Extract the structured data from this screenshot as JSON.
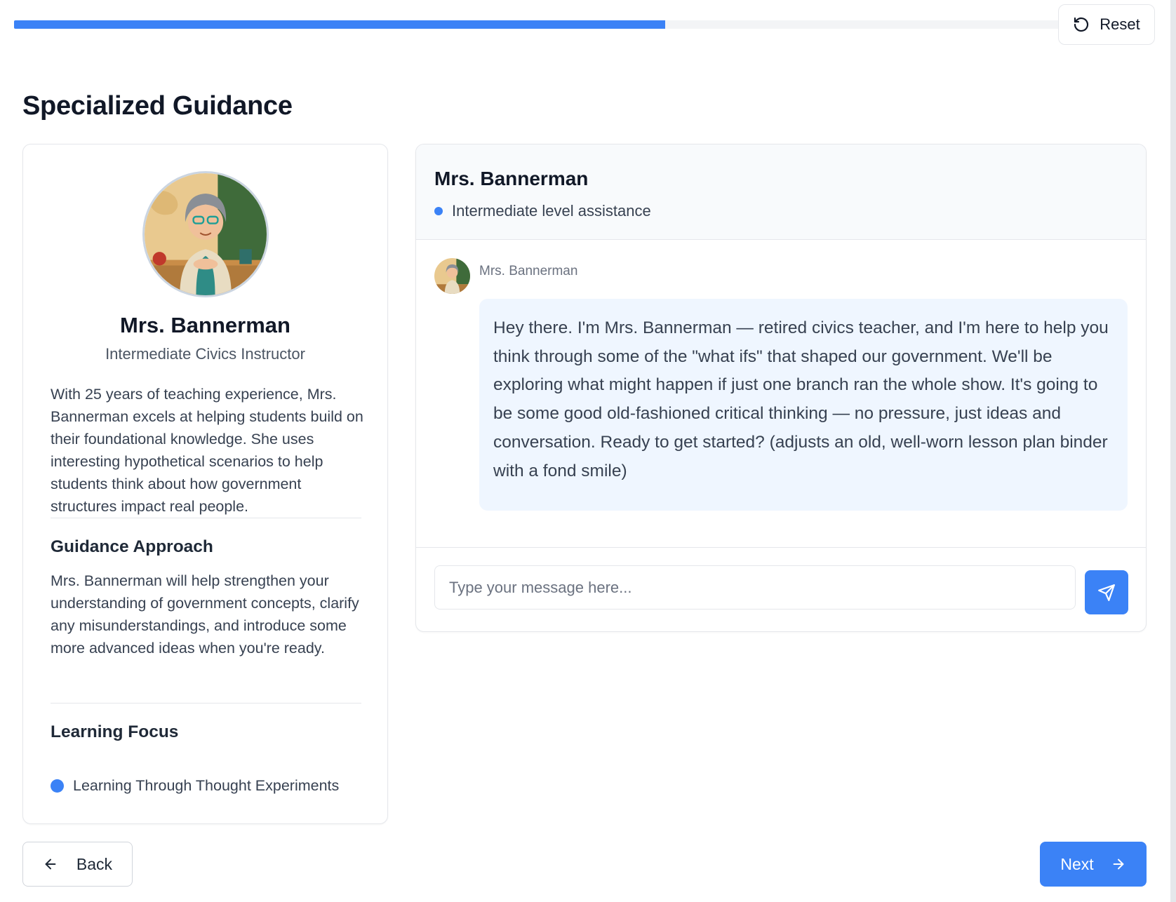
{
  "progress": {
    "fraction": 0.623
  },
  "toolbar": {
    "reset_label": "Reset",
    "reset_icon": "rotate-ccw-icon"
  },
  "page": {
    "title": "Specialized Guidance"
  },
  "profile": {
    "name": "Mrs. Bannerman",
    "role": "Intermediate Civics Instructor",
    "bio": "With 25 years of teaching experience, Mrs. Bannerman excels at helping students build on their foundational knowledge. She uses interesting hypothetical scenarios to help students think about how government structures impact real people.",
    "approach_title": "Guidance Approach",
    "approach_text": "Mrs. Bannerman will help strengthen your understanding of government concepts, clarify any misunderstandings, and introduce some more advanced ideas when you're ready.",
    "focus_title": "Learning Focus",
    "focus_items": [
      "Learning Through Thought Experiments"
    ]
  },
  "chat": {
    "header_name": "Mrs. Bannerman",
    "status": "Intermediate level assistance",
    "messages": [
      {
        "sender": "Mrs. Bannerman",
        "text": "Hey there. I'm Mrs. Bannerman — retired civics teacher, and I'm here to help you think through some of the \"what ifs\" that shaped our government. We'll be exploring what might happen if just one branch ran the whole show. It's going to be some good old-fashioned critical thinking — no pressure, just ideas and conversation. Ready to get started? (adjusts an old, well-worn lesson plan binder with a fond smile)"
      }
    ],
    "input_placeholder": "Type your message here...",
    "input_value": "",
    "send_icon": "send-icon"
  },
  "footer": {
    "back_label": "Back",
    "next_label": "Next"
  },
  "colors": {
    "accent": "#3b82f6",
    "bubble": "#eff6ff",
    "header_bg": "#f8fafc"
  }
}
